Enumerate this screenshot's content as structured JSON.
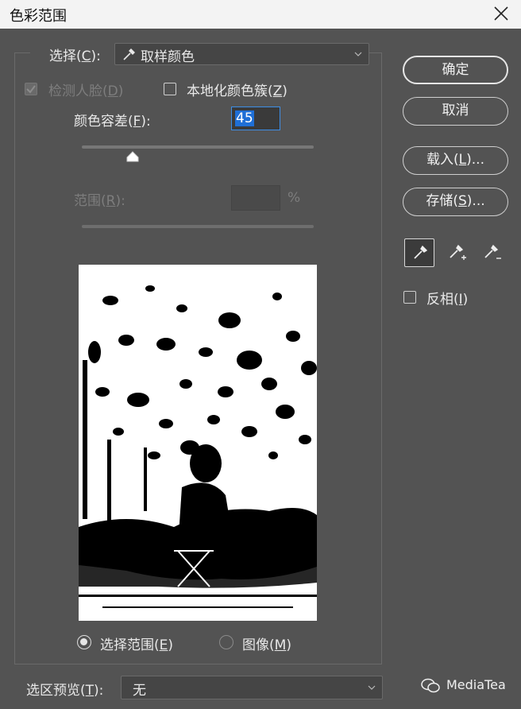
{
  "window": {
    "title": "色彩范围"
  },
  "select_row": {
    "label": "选择(",
    "label_key": "C",
    "label_end": "):",
    "value": "取样颜色"
  },
  "face": {
    "label": "检测人脸(",
    "key": "D",
    "end": ")"
  },
  "localized": {
    "label": "本地化颜色簇(",
    "key": "Z",
    "end": ")"
  },
  "fuzziness": {
    "label": "颜色容差(",
    "key": "F",
    "end": "):",
    "value": "45",
    "slider_fraction": 0.22
  },
  "range": {
    "label": "范围(",
    "key": "R",
    "end": "):",
    "unit": "%"
  },
  "buttons": {
    "ok": "确定",
    "cancel": "取消",
    "load": {
      "text": "载入(",
      "key": "L",
      "end": ")..."
    },
    "save": {
      "text": "存储(",
      "key": "S",
      "end": ")..."
    }
  },
  "invert": {
    "label": "反相(",
    "key": "I",
    "end": ")"
  },
  "view": {
    "selection": {
      "label": "选择范围(",
      "key": "E",
      "end": ")"
    },
    "image": {
      "label": "图像(",
      "key": "M",
      "end": ")"
    }
  },
  "preview_select": {
    "label": "选区预览(",
    "key": "T",
    "end": "):",
    "value": "无"
  },
  "watermark": "MediaTea",
  "colors": {
    "background": "#535353",
    "accent": "#3d8ee6",
    "title_bar": "#f3f3f3"
  }
}
